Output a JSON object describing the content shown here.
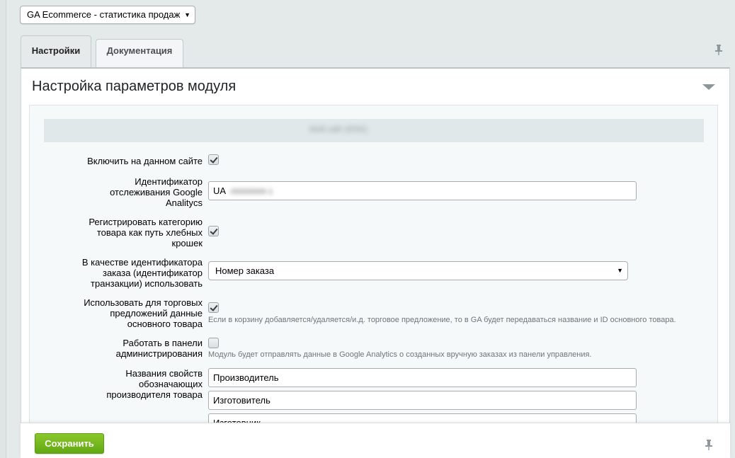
{
  "module_select": {
    "value": "GA Ecommerce - статистика продаж"
  },
  "tabs": [
    {
      "label": "Настройки",
      "active": true
    },
    {
      "label": "Документация",
      "active": false
    }
  ],
  "panel": {
    "title": "Настройка параметров модуля",
    "group_header": "Мой сайт (ENG)"
  },
  "fields": {
    "enable": {
      "label": "Включить на данном сайте",
      "checked": true
    },
    "tracking_id": {
      "label": "Идентификатор отслеживания Google Analitycs",
      "value_prefix": "UA",
      "value_rest": "-00000000-1"
    },
    "breadcrumbs": {
      "label": "Регистрировать категорию товара как путь хлебных крошек",
      "checked": true
    },
    "order_id": {
      "label": "В качестве идентификатора заказа (идентификатор транзакции) использовать",
      "selected": "Номер заказа"
    },
    "offers": {
      "label": "Использовать для торговых предложений данные основного товара",
      "checked": true,
      "hint": "Если в корзину добавляется/удаляется/и.д. торговое предложение, то в GA будет передаваться название и ID основного товара."
    },
    "admin": {
      "label": "Работать в панели администрирования",
      "checked": false,
      "hint": "Модуль будет отправлять данные в Google Analytics о созданных вручную заказах из панели управления."
    },
    "manufacturer": {
      "label": "Названия свойств обозначающих производителя товара",
      "values": [
        "Производитель",
        "Изготовитель",
        "Изготовник"
      ]
    }
  },
  "footer": {
    "save_label": "Сохранить"
  },
  "colors": {
    "save_button": "#6fb51c",
    "background": "#e4e9ea"
  }
}
